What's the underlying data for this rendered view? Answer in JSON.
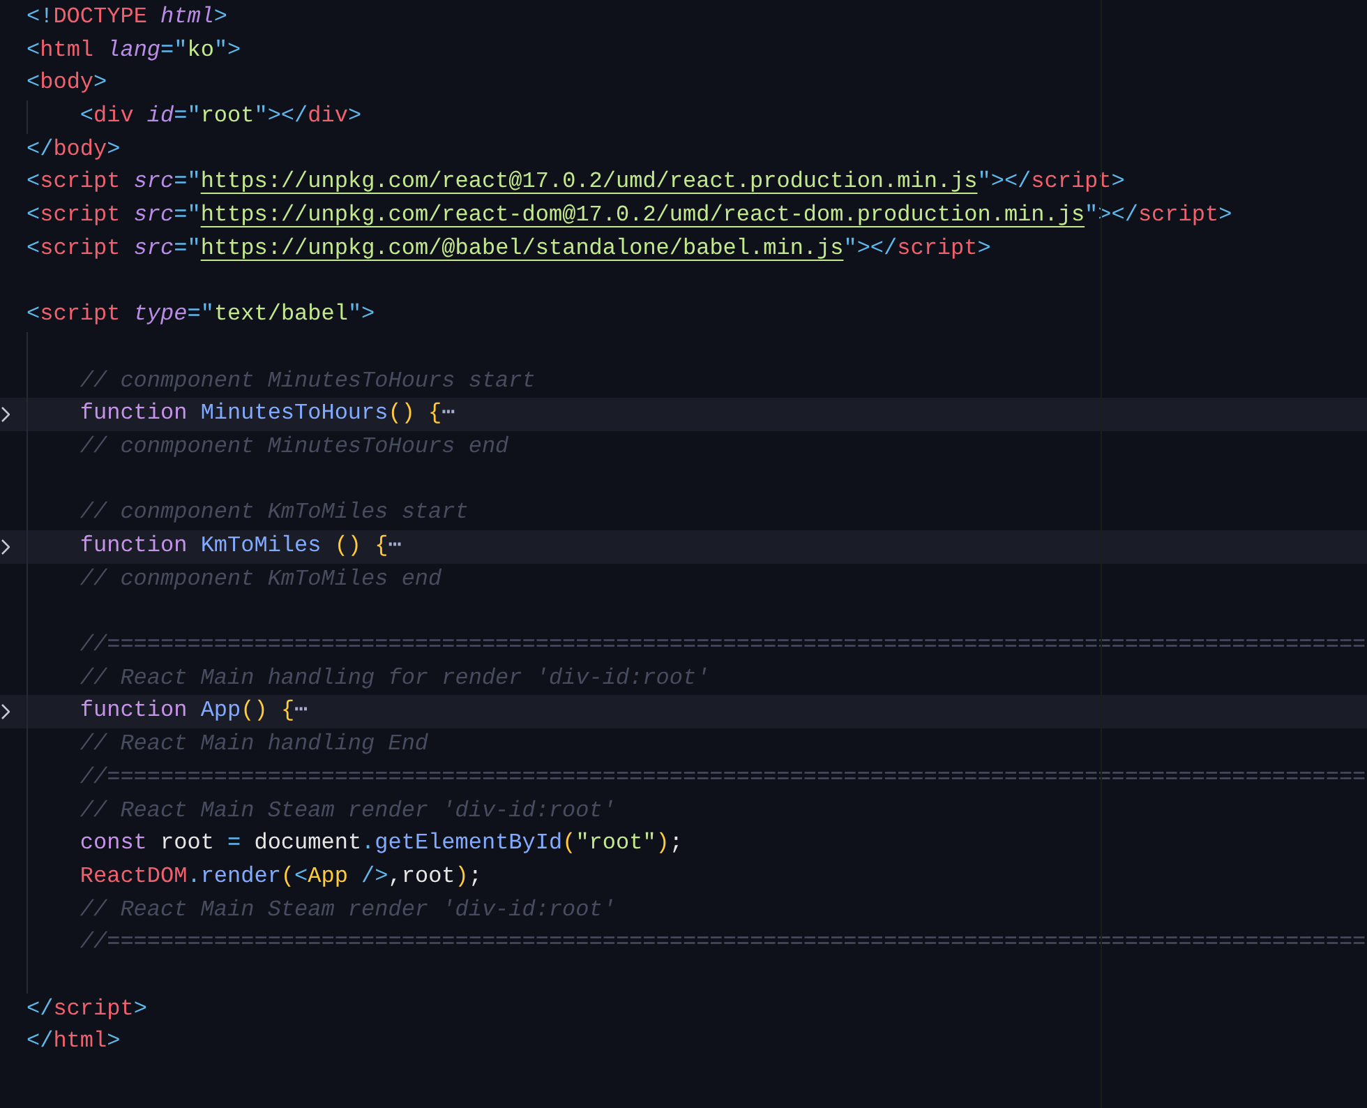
{
  "lines": [
    {
      "indented": false,
      "folded": false,
      "tokens": [
        {
          "text": "<!",
          "kind": "punct"
        },
        {
          "text": "DOCTYPE ",
          "kind": "tag"
        },
        {
          "text": "html",
          "kind": "attr"
        },
        {
          "text": ">",
          "kind": "punct"
        }
      ]
    },
    {
      "indented": false,
      "folded": false,
      "tokens": [
        {
          "text": "<",
          "kind": "punct"
        },
        {
          "text": "html ",
          "kind": "tag"
        },
        {
          "text": "lang",
          "kind": "attr"
        },
        {
          "text": "=\"",
          "kind": "punct"
        },
        {
          "text": "ko",
          "kind": "str"
        },
        {
          "text": "\">",
          "kind": "punct"
        }
      ]
    },
    {
      "indented": false,
      "folded": false,
      "tokens": [
        {
          "text": "<",
          "kind": "punct"
        },
        {
          "text": "body",
          "kind": "tag"
        },
        {
          "text": ">",
          "kind": "punct"
        }
      ]
    },
    {
      "indented": true,
      "folded": false,
      "tokens": [
        {
          "text": "<",
          "kind": "punct"
        },
        {
          "text": "div ",
          "kind": "tag"
        },
        {
          "text": "id",
          "kind": "attr"
        },
        {
          "text": "=\"",
          "kind": "punct"
        },
        {
          "text": "root",
          "kind": "str"
        },
        {
          "text": "\"></",
          "kind": "punct"
        },
        {
          "text": "div",
          "kind": "tag"
        },
        {
          "text": ">",
          "kind": "punct"
        }
      ]
    },
    {
      "indented": false,
      "folded": false,
      "tokens": [
        {
          "text": "</",
          "kind": "punct"
        },
        {
          "text": "body",
          "kind": "tag"
        },
        {
          "text": ">",
          "kind": "punct"
        }
      ]
    },
    {
      "indented": false,
      "folded": false,
      "tokens": [
        {
          "text": "<",
          "kind": "punct"
        },
        {
          "text": "script ",
          "kind": "tag"
        },
        {
          "text": "src",
          "kind": "attr"
        },
        {
          "text": "=\"",
          "kind": "punct"
        },
        {
          "text": "https://unpkg.com/react@17.0.2/umd/react.production.min.js",
          "kind": "link"
        },
        {
          "text": "\"></",
          "kind": "punct"
        },
        {
          "text": "script",
          "kind": "tag"
        },
        {
          "text": ">",
          "kind": "punct"
        }
      ]
    },
    {
      "indented": false,
      "folded": false,
      "tokens": [
        {
          "text": "<",
          "kind": "punct"
        },
        {
          "text": "script ",
          "kind": "tag"
        },
        {
          "text": "src",
          "kind": "attr"
        },
        {
          "text": "=\"",
          "kind": "punct"
        },
        {
          "text": "https://unpkg.com/react-dom@17.0.2/umd/react-dom.production.min.js",
          "kind": "link"
        },
        {
          "text": "\"></",
          "kind": "punct"
        },
        {
          "text": "script",
          "kind": "tag"
        },
        {
          "text": ">",
          "kind": "punct"
        }
      ]
    },
    {
      "indented": false,
      "folded": false,
      "tokens": [
        {
          "text": "<",
          "kind": "punct"
        },
        {
          "text": "script ",
          "kind": "tag"
        },
        {
          "text": "src",
          "kind": "attr"
        },
        {
          "text": "=\"",
          "kind": "punct"
        },
        {
          "text": "https://unpkg.com/@babel/standalone/babel.min.js",
          "kind": "link"
        },
        {
          "text": "\"></",
          "kind": "punct"
        },
        {
          "text": "script",
          "kind": "tag"
        },
        {
          "text": ">",
          "kind": "punct"
        }
      ]
    },
    {
      "indented": false,
      "folded": false
    },
    {
      "indented": false,
      "folded": false,
      "tokens": [
        {
          "text": "<",
          "kind": "punct"
        },
        {
          "text": "script ",
          "kind": "tag"
        },
        {
          "text": "type",
          "kind": "attr"
        },
        {
          "text": "=\"",
          "kind": "punct"
        },
        {
          "text": "text/babel",
          "kind": "str"
        },
        {
          "text": "\">",
          "kind": "punct"
        }
      ]
    },
    {
      "indented": true,
      "folded": false
    },
    {
      "indented": true,
      "folded": false,
      "tokens": [
        {
          "text": "// conmponent MinutesToHours start",
          "kind": "comment"
        }
      ]
    },
    {
      "indented": true,
      "folded": true,
      "tokens": [
        {
          "text": "function ",
          "kind": "kw"
        },
        {
          "text": "MinutesToHours",
          "kind": "fn"
        },
        {
          "text": "() ",
          "kind": "brace"
        },
        {
          "text": "{",
          "kind": "brace"
        },
        {
          "text": "⋯",
          "kind": "ellipsis"
        }
      ]
    },
    {
      "indented": true,
      "folded": false,
      "tokens": [
        {
          "text": "// conmponent MinutesToHours end",
          "kind": "comment"
        }
      ]
    },
    {
      "indented": true,
      "folded": false
    },
    {
      "indented": true,
      "folded": false,
      "tokens": [
        {
          "text": "// conmponent KmToMiles start",
          "kind": "comment"
        }
      ]
    },
    {
      "indented": true,
      "folded": true,
      "tokens": [
        {
          "text": "function ",
          "kind": "kw"
        },
        {
          "text": "KmToMiles ",
          "kind": "fn"
        },
        {
          "text": "() ",
          "kind": "brace"
        },
        {
          "text": "{",
          "kind": "brace"
        },
        {
          "text": "⋯",
          "kind": "ellipsis"
        }
      ]
    },
    {
      "indented": true,
      "folded": false,
      "tokens": [
        {
          "text": "// conmponent KmToMiles end",
          "kind": "comment"
        }
      ]
    },
    {
      "indented": true,
      "folded": false
    },
    {
      "indented": true,
      "folded": false,
      "tokens": [
        {
          "text": "//==============================================================================================",
          "kind": "comment"
        }
      ]
    },
    {
      "indented": true,
      "folded": false,
      "tokens": [
        {
          "text": "// React Main handling for render 'div-id:root'",
          "kind": "comment"
        }
      ]
    },
    {
      "indented": true,
      "folded": true,
      "tokens": [
        {
          "text": "function ",
          "kind": "kw"
        },
        {
          "text": "App",
          "kind": "fn"
        },
        {
          "text": "() ",
          "kind": "brace"
        },
        {
          "text": "{",
          "kind": "brace"
        },
        {
          "text": "⋯",
          "kind": "ellipsis"
        }
      ]
    },
    {
      "indented": true,
      "folded": false,
      "tokens": [
        {
          "text": "// React Main handling End",
          "kind": "comment"
        }
      ]
    },
    {
      "indented": true,
      "folded": false,
      "tokens": [
        {
          "text": "//==============================================================================================",
          "kind": "comment"
        }
      ]
    },
    {
      "indented": true,
      "folded": false,
      "tokens": [
        {
          "text": "// React Main Steam render 'div-id:root'",
          "kind": "comment"
        }
      ]
    },
    {
      "indented": true,
      "folded": false,
      "tokens": [
        {
          "text": "const",
          "kind": "kw"
        },
        {
          "text": " root ",
          "kind": "plain"
        },
        {
          "text": "=",
          "kind": "punct"
        },
        {
          "text": " document",
          "kind": "plain"
        },
        {
          "text": ".",
          "kind": "punct"
        },
        {
          "text": "getElementById",
          "kind": "fn"
        },
        {
          "text": "(",
          "kind": "brace"
        },
        {
          "text": "\"root\"",
          "kind": "str"
        },
        {
          "text": ")",
          "kind": "brace"
        },
        {
          "text": ";",
          "kind": "plain"
        }
      ]
    },
    {
      "indented": true,
      "folded": false,
      "tokens": [
        {
          "text": "ReactDOM",
          "kind": "tag"
        },
        {
          "text": ".",
          "kind": "punct"
        },
        {
          "text": "render",
          "kind": "fn"
        },
        {
          "text": "(",
          "kind": "brace"
        },
        {
          "text": "<",
          "kind": "punct"
        },
        {
          "text": "App",
          "kind": "brace"
        },
        {
          "text": " />",
          "kind": "punct"
        },
        {
          "text": ",root",
          "kind": "plain"
        },
        {
          "text": ")",
          "kind": "brace"
        },
        {
          "text": ";",
          "kind": "plain"
        }
      ]
    },
    {
      "indented": true,
      "folded": false,
      "tokens": [
        {
          "text": "// React Main Steam render 'div-id:root'",
          "kind": "comment"
        }
      ]
    },
    {
      "indented": true,
      "folded": false,
      "tokens": [
        {
          "text": "//==============================================================================================",
          "kind": "comment"
        }
      ]
    },
    {
      "indented": true,
      "folded": false
    },
    {
      "indented": false,
      "folded": false,
      "tokens": [
        {
          "text": "</",
          "kind": "punct"
        },
        {
          "text": "script",
          "kind": "tag"
        },
        {
          "text": ">",
          "kind": "punct"
        }
      ]
    },
    {
      "indented": false,
      "folded": false,
      "tokens": [
        {
          "text": "</",
          "kind": "punct"
        },
        {
          "text": "html",
          "kind": "tag"
        },
        {
          "text": ">",
          "kind": "punct"
        }
      ]
    }
  ]
}
